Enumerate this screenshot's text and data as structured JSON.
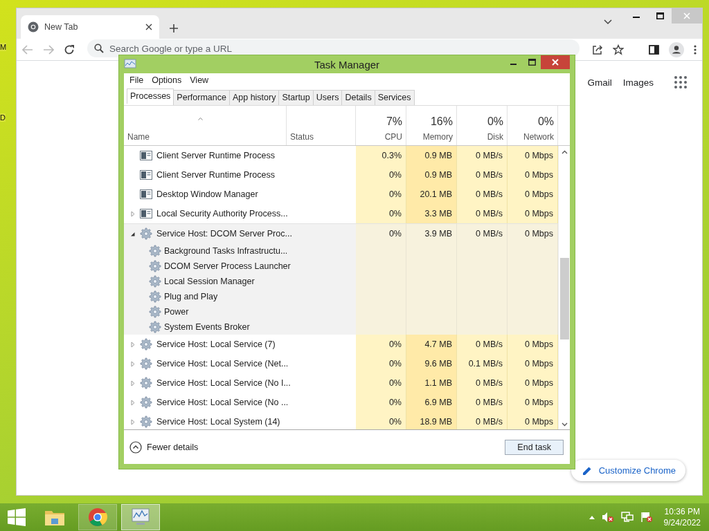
{
  "desktop": {
    "labels": [
      "M",
      "D"
    ]
  },
  "browser": {
    "tabs": [
      {
        "title": "New Tab",
        "selected": true
      }
    ],
    "address": {
      "placeholder": "Search Google or type a URL"
    },
    "links": [
      "Gmail",
      "Images"
    ],
    "customize_button": "Customize Chrome"
  },
  "task_manager": {
    "title": "Task Manager",
    "menu": [
      "File",
      "Options",
      "View"
    ],
    "tabs": [
      {
        "label": "Processes",
        "selected": true
      },
      {
        "label": "Performance",
        "selected": false
      },
      {
        "label": "App history",
        "selected": false
      },
      {
        "label": "Startup",
        "selected": false
      },
      {
        "label": "Users",
        "selected": false
      },
      {
        "label": "Details",
        "selected": false
      },
      {
        "label": "Services",
        "selected": false
      }
    ],
    "columns": [
      {
        "label": "Name"
      },
      {
        "label": "Status"
      },
      {
        "label": "CPU",
        "total": "7%"
      },
      {
        "label": "Memory",
        "total": "16%"
      },
      {
        "label": "Disk",
        "total": "0%"
      },
      {
        "label": "Network",
        "total": "0%"
      }
    ],
    "rows": [
      {
        "name": "Client Server Runtime Process",
        "kind": "app",
        "cpu": "0.3%",
        "memory": "0.9 MB",
        "disk": "0 MB/s",
        "network": "0 Mbps"
      },
      {
        "name": "Client Server Runtime Process",
        "kind": "app",
        "cpu": "0%",
        "memory": "0.9 MB",
        "disk": "0 MB/s",
        "network": "0 Mbps"
      },
      {
        "name": "Desktop Window Manager",
        "kind": "app",
        "cpu": "0%",
        "memory": "20.1 MB",
        "disk": "0 MB/s",
        "network": "0 Mbps"
      },
      {
        "name": "Local Security Authority Process...",
        "kind": "app",
        "expanded": false,
        "cpu": "0%",
        "memory": "3.3 MB",
        "disk": "0 MB/s",
        "network": "0 Mbps"
      },
      {
        "name": "Service Host: DCOM Server Proc...",
        "kind": "service",
        "expanded": true,
        "cpu": "0%",
        "memory": "3.9 MB",
        "disk": "0 MB/s",
        "network": "0 Mbps",
        "children": [
          {
            "name": "Background Tasks Infrastructu..."
          },
          {
            "name": "DCOM Server Process Launcher"
          },
          {
            "name": "Local Session Manager"
          },
          {
            "name": "Plug and Play"
          },
          {
            "name": "Power"
          },
          {
            "name": "System Events Broker"
          }
        ]
      },
      {
        "name": "Service Host: Local Service (7)",
        "kind": "service",
        "expanded": false,
        "cpu": "0%",
        "memory": "4.7 MB",
        "disk": "0 MB/s",
        "network": "0 Mbps"
      },
      {
        "name": "Service Host: Local Service (Net...",
        "kind": "service",
        "expanded": false,
        "cpu": "0%",
        "memory": "9.6 MB",
        "disk": "0.1 MB/s",
        "network": "0 Mbps"
      },
      {
        "name": "Service Host: Local Service (No I...",
        "kind": "service",
        "expanded": false,
        "cpu": "0%",
        "memory": "1.1 MB",
        "disk": "0 MB/s",
        "network": "0 Mbps"
      },
      {
        "name": "Service Host: Local Service (No ...",
        "kind": "service",
        "expanded": false,
        "cpu": "0%",
        "memory": "6.9 MB",
        "disk": "0 MB/s",
        "network": "0 Mbps"
      },
      {
        "name": "Service Host: Local System (14)",
        "kind": "service",
        "expanded": false,
        "cpu": "0%",
        "memory": "18.9 MB",
        "disk": "0 MB/s",
        "network": "0 Mbps"
      }
    ],
    "footer": {
      "details_link": "Fewer details",
      "end_task": "End task"
    }
  },
  "taskbar": {
    "apps": [
      {
        "kind": "explorer",
        "running": false,
        "selected": false
      },
      {
        "kind": "chrome",
        "running": true,
        "selected": false
      },
      {
        "kind": "taskmanager",
        "running": true,
        "selected": true
      }
    ],
    "clock": {
      "time": "10:36 PM",
      "date": "9/24/2022"
    }
  }
}
